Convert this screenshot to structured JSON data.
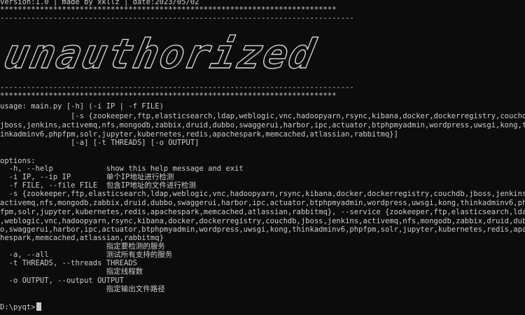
{
  "header": {
    "version_line": "version:1.0 | made by xkllz | date:2023/05/02",
    "stars_line": "****************************************************************************",
    "dash_line": "--------------------------------------------------------------------------------"
  },
  "banner": {
    "text": "unauthorized"
  },
  "usage": {
    "line1": "usage: main.py [-h] (-i IP | -f FILE)",
    "line2": "                [-s {zookeeper,ftp,elasticsearch,ldap,weblogic,vnc,hadoopyarn,rsync,kibana,docker,dockerregistry,couchdb,",
    "line3": "jboss,jenkins,activemq,nfs,mongodb,zabbix,druid,dubbo,swaggerui,harbor,ipc,actuator,btphpmyadmin,wordpress,uwsgi,kong,th",
    "line4": "inkadminv6,phpfpm,solr,jupyter,kubernetes,redis,apachespark,memcached,atlassian,rabbitmq}]",
    "line5": "                [-a] [-t THREADS] [-o OUTPUT]"
  },
  "options": {
    "heading": "options:",
    "help": "  -h, --help            show this help message and exit",
    "ip": "  -i IP, --ip IP        单个IP地址进行检测",
    "file": "  -f FILE, --file FILE  包含IP地址的文件进行检测",
    "s1": "  -s {zookeeper,ftp,elasticsearch,ldap,weblogic,vnc,hadoopyarn,rsync,kibana,docker,dockerregistry,couchdb,jboss,jenkins,",
    "s2": "activemq,nfs,mongodb,zabbix,druid,dubbo,swaggerui,harbor,ipc,actuator,btphpmyadmin,wordpress,uwsgi,kong,thinkadminv6,php",
    "s3": "fpm,solr,jupyter,kubernetes,redis,apachespark,memcached,atlassian,rabbitmq}, --service {zookeeper,ftp,elasticsearch,ldap",
    "s4": ",weblogic,vnc,hadoopyarn,rsync,kibana,docker,dockerregistry,couchdb,jboss,jenkins,activemq,nfs,mongodb,zabbix,druid,dubb",
    "s5": "o,swaggerui,harbor,ipc,actuator,btphpmyadmin,wordpress,uwsgi,kong,thinkadminv6,phpfpm,solr,jupyter,kubernetes,redis,apac",
    "s6": "hespark,memcached,atlassian,rabbitmq}",
    "s_desc": "                        指定要检测的服务",
    "all": "  -a, --all             测试所有支持的服务",
    "threads": "  -t THREADS, --threads THREADS",
    "threads_desc": "                        指定线程数",
    "output": "  -o OUTPUT, --output OUTPUT",
    "output_desc": "                        指定输出文件路径"
  },
  "prompt": {
    "text": "D:\\pyqt>"
  }
}
